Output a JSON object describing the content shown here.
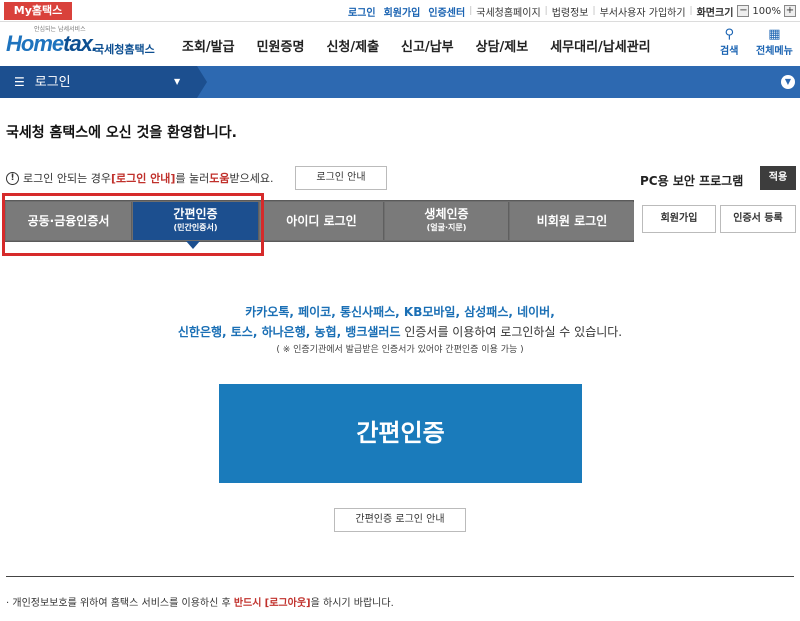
{
  "util": {
    "my_home": "My홈택스",
    "links": [
      "로그인",
      "회원가입",
      "인증센터",
      "국세청홈페이지",
      "법령정보",
      "부서사용자 가입하기",
      "화면크기"
    ],
    "zoom": "100%"
  },
  "header": {
    "logo_small": "안심되는 납세서비스",
    "logo_main_a": "Home",
    "logo_main_b": "tax.",
    "logo_kr": "국세청홈택스",
    "nav": [
      "조회/발급",
      "민원증명",
      "신청/제출",
      "신고/납부",
      "상담/제보",
      "세무대리/납세관리"
    ],
    "search_label": "검색",
    "all_menu_label": "전체메뉴"
  },
  "locbar": {
    "label": "로그인"
  },
  "welcome": "국세청 홈택스에 오신 것을 환영합니다.",
  "notice": {
    "pre": "로그인 안되는 경우 ",
    "red1": "[로그인 안내]",
    "mid": "를 눌러 ",
    "red2": "도움",
    "post": "받으세요.",
    "button": "로그인 안내"
  },
  "pc_security": {
    "label": "PC용 보안 프로그램",
    "apply": "적용"
  },
  "tabs": [
    {
      "label": "공동·금융인증서",
      "sub": ""
    },
    {
      "label": "간편인증",
      "sub": "(민간인증서)"
    },
    {
      "label": "아이디 로그인",
      "sub": ""
    },
    {
      "label": "생체인증",
      "sub": "(얼굴·지문)"
    },
    {
      "label": "비회원 로그인",
      "sub": ""
    }
  ],
  "side_buttons": {
    "join": "회원가입",
    "cert_register": "인증서 등록"
  },
  "main": {
    "line1": "카카오톡, 페이코, 통신사패스, KB모바일, 삼성패스, 네이버,",
    "line2_blue": "신한은행, 토스, 하나은행, 농협, 뱅크샐러드",
    "line2_rest": " 인증서를 이용하여 로그인하실 수 있습니다.",
    "line3": "( ※ 인증기관에서 발급받은 인증서가 있어야 간편인증 이용 가능 )",
    "big_button": "간편인증",
    "guide_button": "간편인증 로그인 안내"
  },
  "footer": {
    "pre": "개인정보보호를 위하여 홈택스 서비스를 이용하신 후 ",
    "red1": "반드시",
    "mid": " ",
    "red2": "[로그아웃]",
    "post": "을 하시기 바랍니다."
  }
}
